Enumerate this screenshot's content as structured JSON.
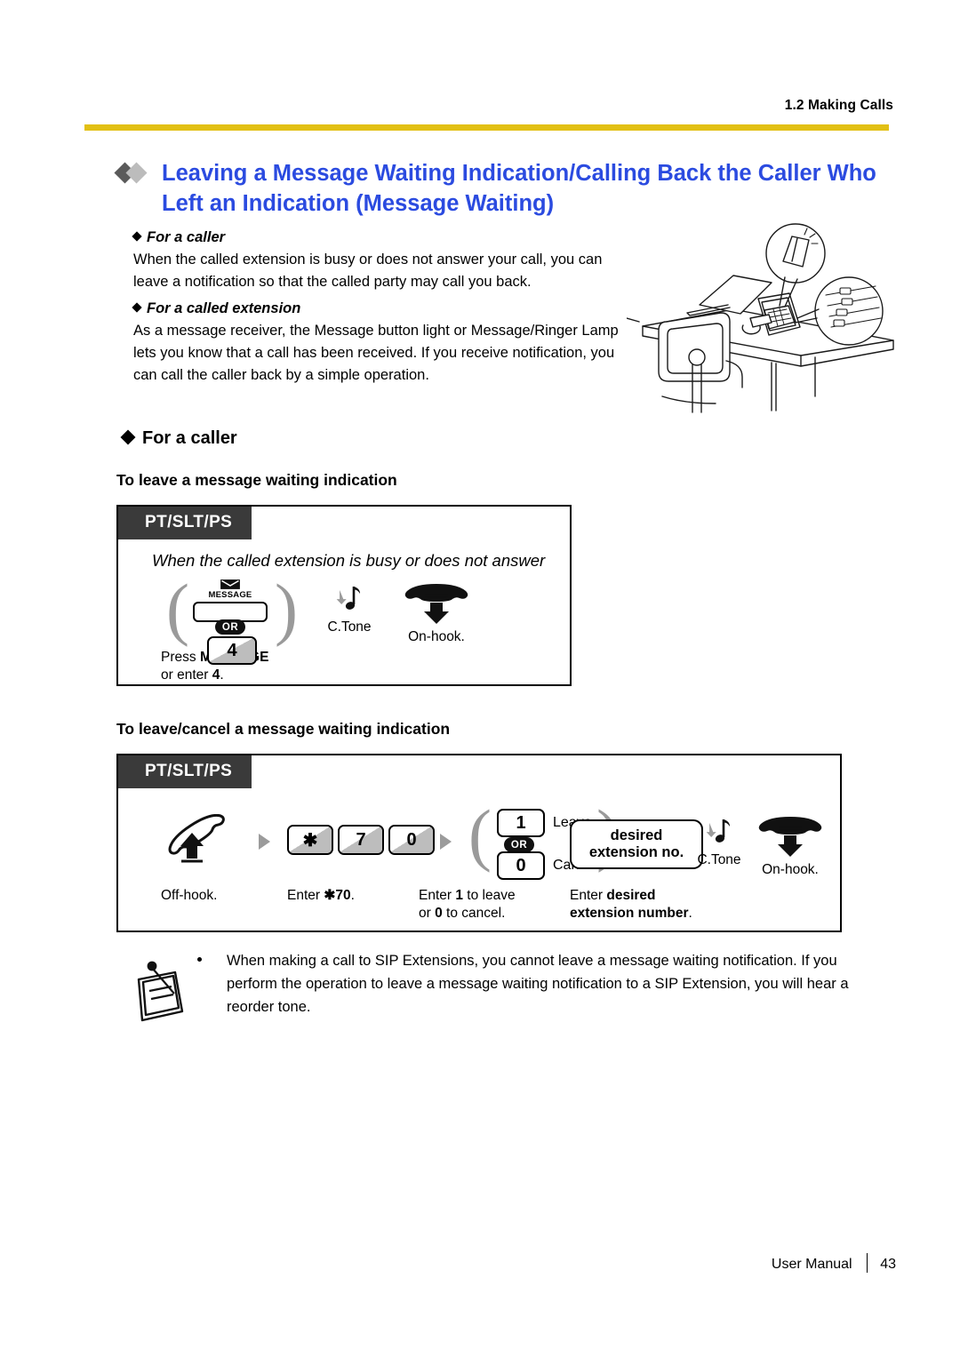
{
  "header": {
    "section_label": "1.2 Making Calls"
  },
  "title": {
    "text": "Leaving a Message Waiting Indication/Calling Back the Caller Who Left an Indication (Message Waiting)",
    "color": "#2B4BE0"
  },
  "intro": {
    "caller_heading": "For a caller",
    "caller_text": "When the called extension is busy or does not answer your call, you can leave a notification so that the called party may call you back.",
    "called_heading": "For a called extension",
    "called_text": "As a message receiver, the Message button light or Message/Ringer Lamp lets you know that a call has been received. If you receive notification, you can call the caller back by a simple operation."
  },
  "illustration": {
    "name": "desk-with-phone-illustration"
  },
  "section": {
    "heading": "For a caller"
  },
  "proc1": {
    "subheading": "To leave a message waiting indication",
    "tag": "PT/SLT/PS",
    "caption": "When the called extension is busy or does not answer",
    "message_icon_label": "MESSAGE",
    "or_label": "OR",
    "key4": "4",
    "label_press": "Press MESSAGE",
    "label_press_plain": "Press ",
    "label_press_bold": "MESSAGE",
    "label_enter_plain": "or enter ",
    "label_enter_bold": "4",
    "label_enter_tail": ".",
    "ctone": "C.Tone",
    "onhook": "On-hook."
  },
  "proc2": {
    "subheading": "To leave/cancel a message waiting indication",
    "tag": "PT/SLT/PS",
    "keys": [
      "✱",
      "7",
      "0"
    ],
    "leave_key": "1",
    "leave_label": "Leave",
    "or_label": "OR",
    "cancel_key": "0",
    "cancel_label": "Cancel",
    "desired_line1": "desired",
    "desired_line2": "extension no.",
    "ctone": "C.Tone",
    "step_offhook": "Off-hook.",
    "step_enter_plain": "Enter ",
    "step_enter_code": "✱70",
    "step_enter_tail": ".",
    "step_leave_l1_a": "Enter ",
    "step_leave_l1_b": "1",
    "step_leave_l1_c": " to leave",
    "step_leave_l2_a": "or ",
    "step_leave_l2_b": "0",
    "step_leave_l2_c": " to cancel.",
    "step_desired_l1_a": "Enter ",
    "step_desired_l1_b": "desired",
    "step_desired_l2_b": "extension number",
    "step_desired_l2_c": ".",
    "step_onhook": "On-hook."
  },
  "note": {
    "icon": "notepad-pencil-icon",
    "text": "When making a call to SIP Extensions, you cannot leave a message waiting notification. If you perform the operation to leave a message waiting notification to a SIP Extension, you will hear a reorder tone."
  },
  "footer": {
    "label": "User Manual",
    "page": "43"
  },
  "colors": {
    "rule": "#E2C014",
    "tag_bg": "#3A3A3A",
    "key_shade": "#BDBDBD",
    "arrow": "#9B9B9B"
  }
}
